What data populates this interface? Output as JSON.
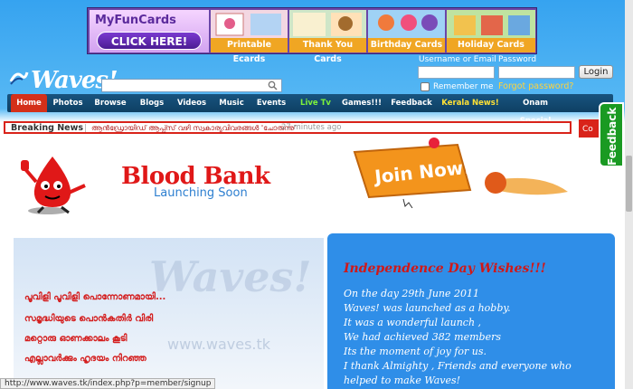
{
  "ad": {
    "brand": "MyFunCards",
    "cta": "CLICK HERE!",
    "tiles": [
      "Printable Ecards",
      "Thank You Cards",
      "Birthday Cards",
      "Holiday Cards"
    ]
  },
  "logo": {
    "text": "Waves!"
  },
  "search": {
    "placeholder": ""
  },
  "login": {
    "username_label": "Username or Email",
    "password_label": "Password",
    "button": "Login",
    "remember": "Remember me",
    "forgot": "Forgot password?"
  },
  "nav": {
    "items": [
      "Home",
      "Photos",
      "Browse",
      "Blogs",
      "Videos",
      "Music",
      "Events",
      "Live Tv",
      "Games!!!",
      "Feedback",
      "Kerala News!",
      "Onam Special"
    ]
  },
  "breaking": {
    "label": "Breaking News",
    "headline": "ആൻഡ്രോയിഡ് ആപ്പ്സ് വഴി സ്വകാര്യവിവരങ്ങൾ 'ചോരുന്നു'",
    "time": "27 minutes ago",
    "right_fragment": "Co"
  },
  "feedback_tab": "Feedback",
  "bloodbank": {
    "title": "Blood Bank",
    "subtitle": "Launching Soon"
  },
  "join": {
    "label": "Join Now!"
  },
  "left_panel": {
    "watermark": "Waves!",
    "watermark_url": "www.waves.tk",
    "lines": [
      "പൂവിളി പൂവിളി പൊന്നോണമായി...",
      "സമൃദ്ധിയുടെ പൊൻകതിർ വിരി",
      "മറ്റൊരു ഓണക്കാലം കൂടി",
      "എല്ലാവർക്കും ഹൃദയം നിറഞ്ഞ"
    ]
  },
  "right_panel": {
    "title": "Independence Day Wishes!!!",
    "lines": [
      "On the day 29th June 2011",
      "Waves! was launched as a hobby.",
      "It was a wonderful launch ,",
      "We had achieved 382 members",
      "Its the moment of joy for us.",
      "I thank Almighty , Friends and everyone who",
      "helped to make Waves!"
    ]
  },
  "status_url": "http://www.waves.tk/index.php?p=member/signup",
  "colors": {
    "accent_red": "#d4301a",
    "nav_bg": "#18547f",
    "panel_blue": "#2f8ee8"
  }
}
